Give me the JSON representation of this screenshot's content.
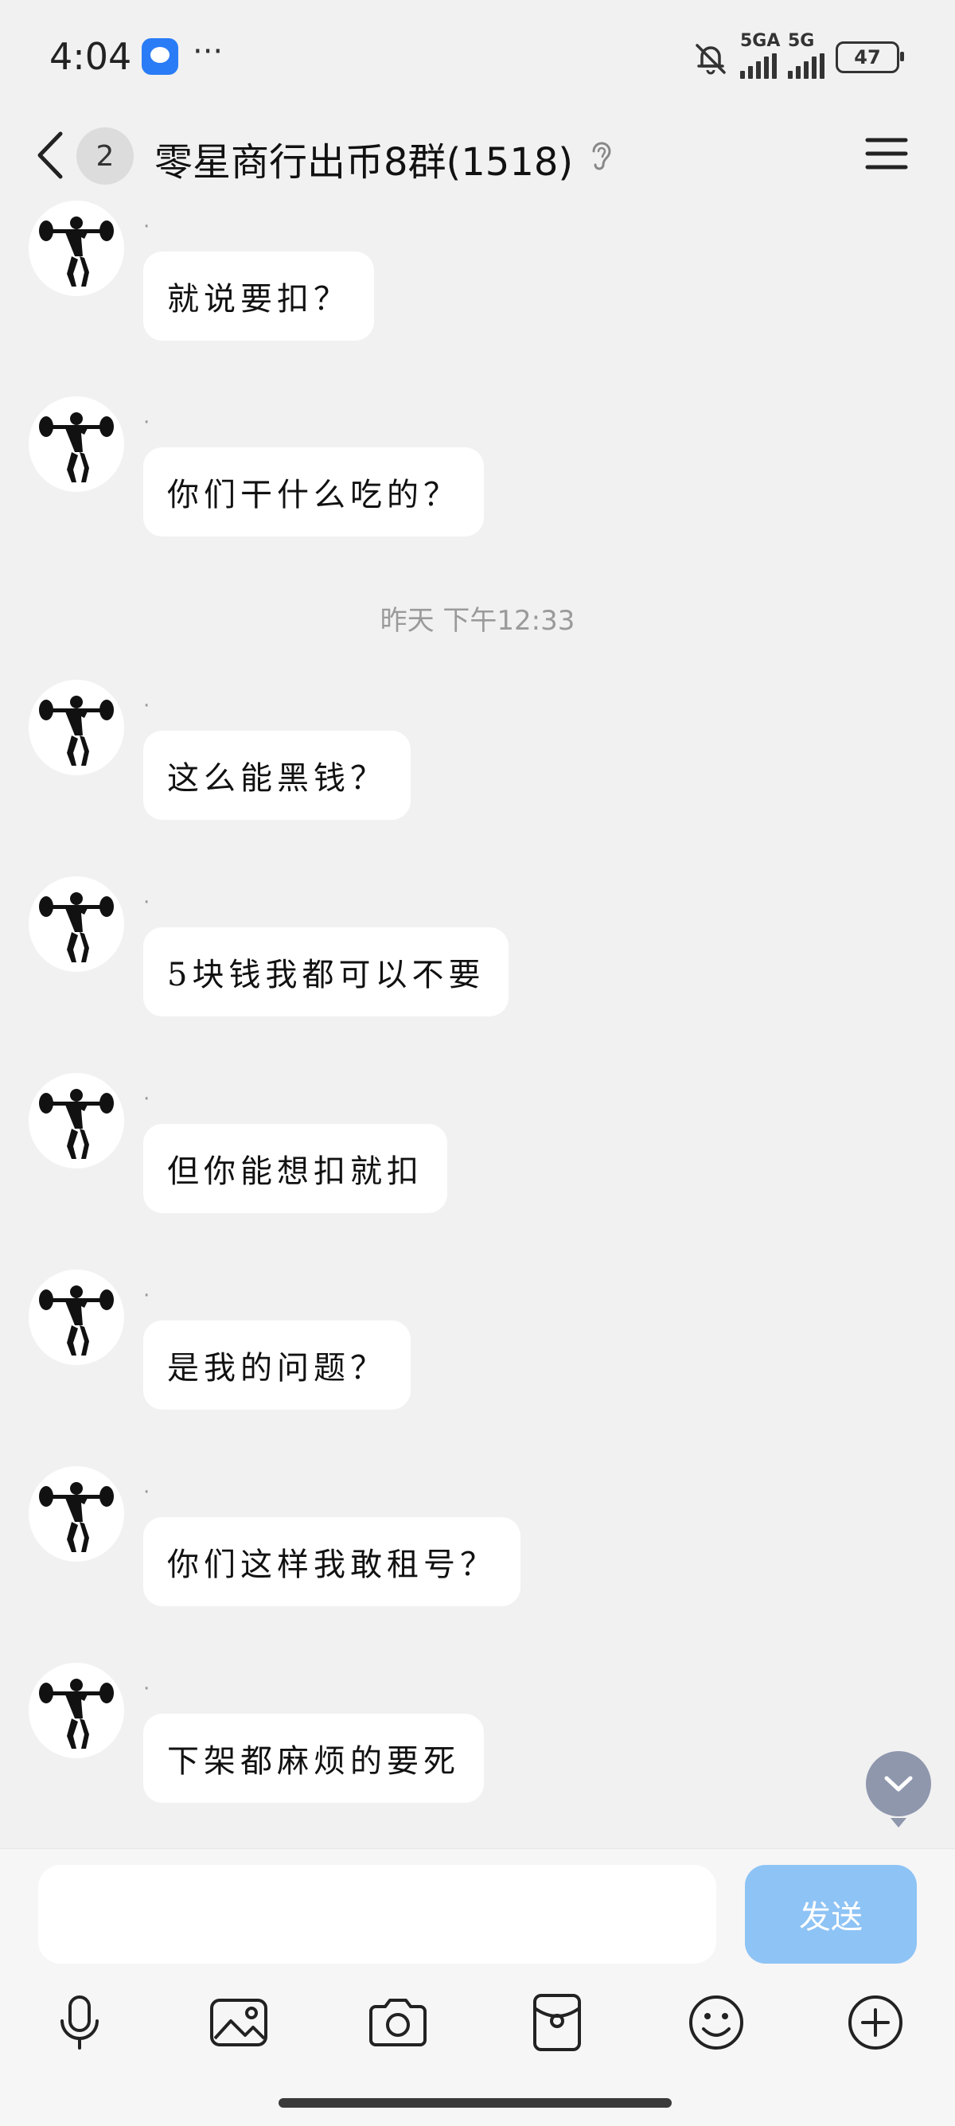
{
  "status_bar": {
    "time": "4:04",
    "more": "···",
    "network1": "5GA",
    "network2": "5G",
    "battery": "47"
  },
  "header": {
    "unread_count": "2",
    "title": "零星商行出币8群(1518)"
  },
  "messages": [
    {
      "sender": "·",
      "text": "就说要扣？"
    },
    {
      "sender": "·",
      "text": "你们干什么吃的？"
    },
    {
      "sender": "·",
      "text": "这么能黑钱？"
    },
    {
      "sender": "·",
      "text": "5块钱我都可以不要"
    },
    {
      "sender": "·",
      "text": "但你能想扣就扣"
    },
    {
      "sender": "·",
      "text": "是我的问题？"
    },
    {
      "sender": "·",
      "text": "你们这样我敢租号？"
    },
    {
      "sender": "·",
      "text": "下架都麻烦的要死"
    }
  ],
  "timestamp": "昨天 下午12:33",
  "input": {
    "placeholder": "",
    "send_label": "发送"
  },
  "toolbar": [
    "mic-icon",
    "image-icon",
    "camera-icon",
    "red-packet-icon",
    "emoji-icon",
    "plus-icon"
  ]
}
